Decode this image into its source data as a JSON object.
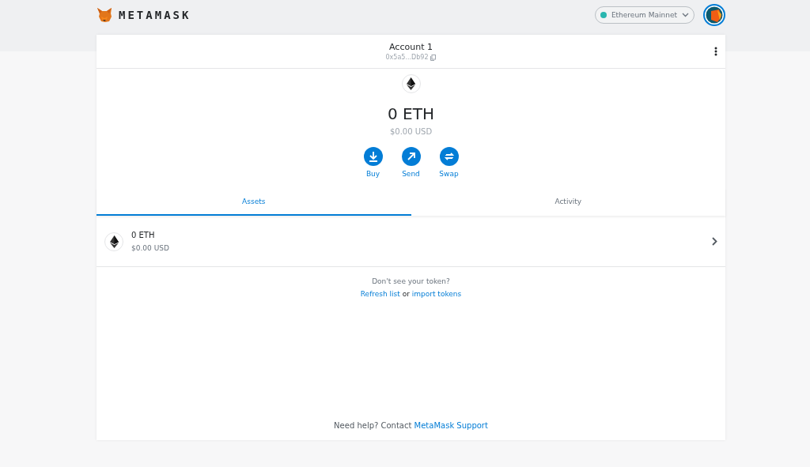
{
  "header": {
    "logo_text": "METAMASK",
    "network": {
      "label": "Ethereum Mainnet"
    }
  },
  "account": {
    "name": "Account 1",
    "address": "0x5a5...Db92"
  },
  "balance": {
    "primary": "0 ETH",
    "secondary": "$0.00 USD"
  },
  "actions": [
    {
      "label": "Buy",
      "kind": "buy"
    },
    {
      "label": "Send",
      "kind": "send"
    },
    {
      "label": "Swap",
      "kind": "swap"
    }
  ],
  "tabs": [
    {
      "label": "Assets",
      "selected": true
    },
    {
      "label": "Activity",
      "selected": false
    }
  ],
  "assets": [
    {
      "amount": "0 ETH",
      "value": "$0.00 USD"
    }
  ],
  "token_help": {
    "prompt": "Don't see your token?",
    "refresh_link": "Refresh list",
    "joiner": "or",
    "import_link": "import tokens"
  },
  "footer": {
    "text": "Need help? Contact",
    "link": "MetaMask Support"
  }
}
